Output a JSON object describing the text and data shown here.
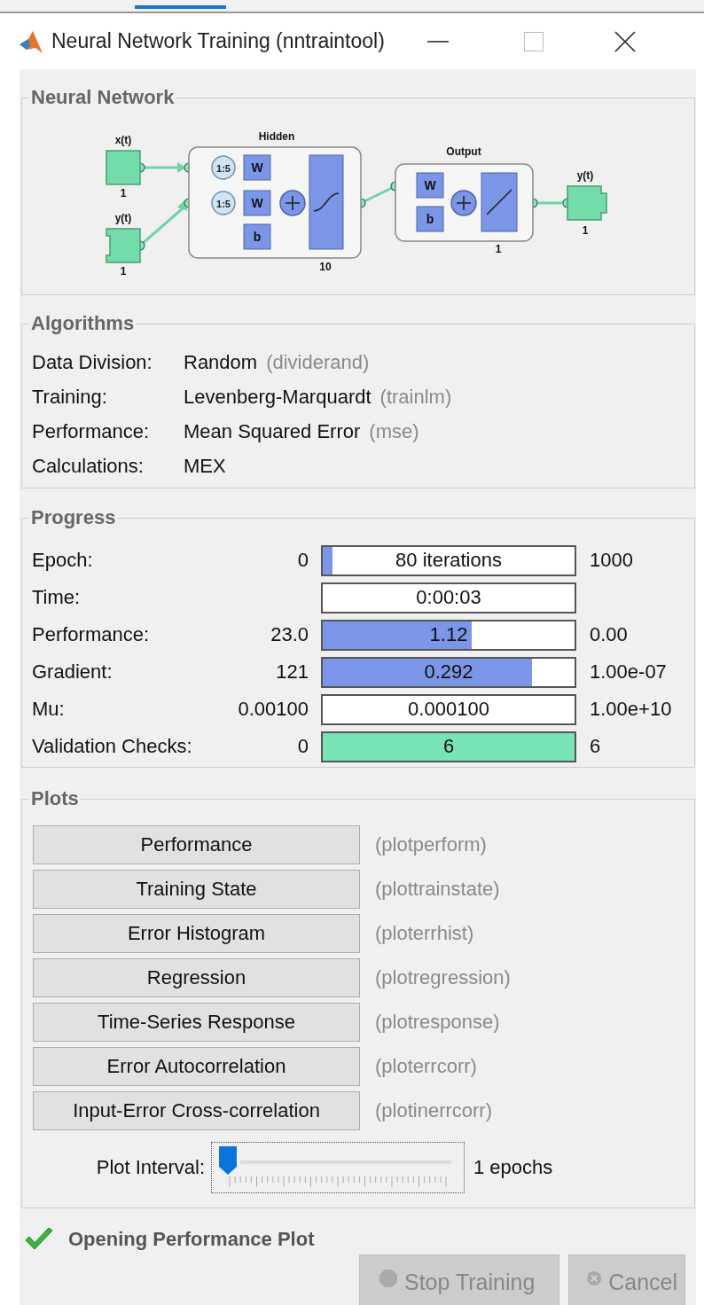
{
  "window": {
    "title": "Neural Network Training (nntraintool)"
  },
  "network": {
    "title": "Neural Network",
    "inputs": [
      {
        "name": "x(t)",
        "size": "1"
      },
      {
        "name": "y(t)",
        "size": "1"
      }
    ],
    "layers": [
      {
        "name": "Hidden",
        "size": "10",
        "delays": [
          "1:5",
          "1:5"
        ],
        "weights": [
          "W",
          "W"
        ],
        "bias": "b",
        "kind": "sigmoid"
      },
      {
        "name": "Output",
        "size": "1",
        "weights": [
          "W"
        ],
        "bias": "b",
        "kind": "linear"
      }
    ],
    "output": {
      "name": "y(t)",
      "size": "1"
    }
  },
  "algorithms": {
    "title": "Algorithms",
    "rows": [
      {
        "label": "Data Division:",
        "value": "Random",
        "function": "(dividerand)"
      },
      {
        "label": "Training:",
        "value": "Levenberg-Marquardt",
        "function": "(trainlm)"
      },
      {
        "label": "Performance:",
        "value": "Mean Squared Error",
        "function": "(mse)"
      },
      {
        "label": "Calculations:",
        "value": "MEX"
      }
    ]
  },
  "progress": {
    "title": "Progress",
    "rows": [
      {
        "label": "Epoch:",
        "start": "0",
        "value": "80 iterations",
        "end": "1000",
        "level": 0.04,
        "color": "#7b96e6"
      },
      {
        "label": "Time:",
        "value": "0:00:03"
      },
      {
        "label": "Performance:",
        "start": "23.0",
        "value": "1.12",
        "end": "0.00",
        "level": 0.59,
        "color": "#7b96e6"
      },
      {
        "label": "Gradient:",
        "start": "121",
        "value": "0.292",
        "end": "1.00e-07",
        "level": 0.83,
        "color": "#7b96e6"
      },
      {
        "label": "Mu:",
        "start": "0.00100",
        "value": "0.000100",
        "end": "1.00e+10"
      },
      {
        "label": "Validation Checks:",
        "start": "0",
        "value": "6",
        "end": "6",
        "level": 1,
        "color": "#78e3b4"
      }
    ]
  },
  "plots": {
    "title": "Plots",
    "buttons": [
      {
        "label": "Performance",
        "function": "(plotperform)"
      },
      {
        "label": "Training State",
        "function": "(plottrainstate)"
      },
      {
        "label": "Error Histogram",
        "function": "(ploterrhist)"
      },
      {
        "label": "Regression",
        "function": "(plotregression)"
      },
      {
        "label": "Time-Series Response",
        "function": "(plotresponse)"
      },
      {
        "label": "Error Autocorrelation",
        "function": "(ploterrcorr)"
      },
      {
        "label": "Input-Error Cross-correlation",
        "function": "(plotinerrcorr)"
      }
    ],
    "interval": {
      "label": "Plot Interval:",
      "level": 0,
      "reading": "1 epochs"
    }
  },
  "status": {
    "text": "Opening Performance Plot",
    "ok": true
  },
  "buttons": [
    {
      "label": "Stop Training",
      "kind": "stop",
      "disabled": true
    },
    {
      "label": "Cancel",
      "kind": "cancel",
      "disabled": true
    }
  ]
}
